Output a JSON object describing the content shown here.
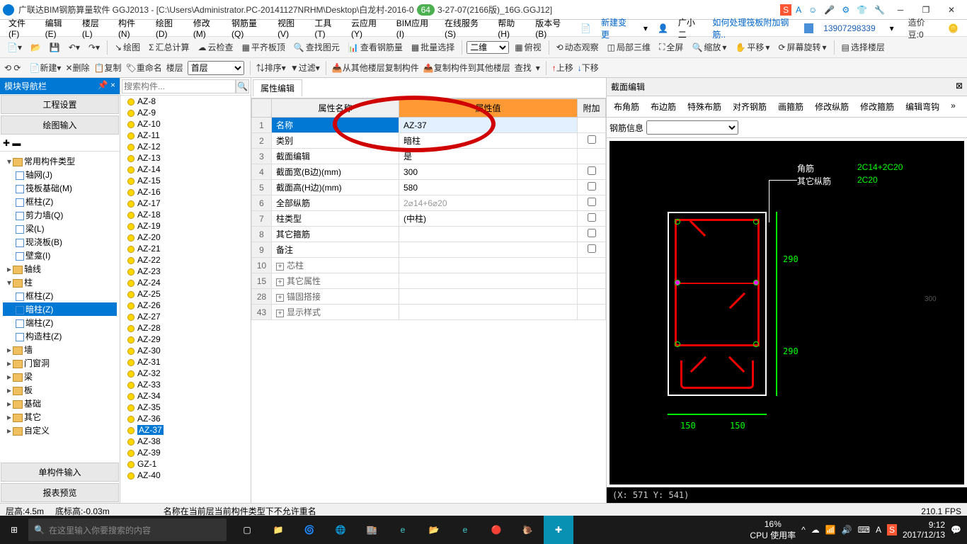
{
  "titlebar": {
    "title": "广联达BIM钢筋算量软件 GGJ2013 - [C:\\Users\\Administrator.PC-20141127NRHM\\Desktop\\白龙村-2016-0",
    "badge": "64",
    "title2": "3-27-07(2166版)_16G.GGJ12]"
  },
  "menu": [
    "文件(F)",
    "编辑(E)",
    "楼层(L)",
    "构件(N)",
    "绘图(D)",
    "修改(M)",
    "钢筋量(Q)",
    "视图(V)",
    "工具(T)",
    "云应用(Y)",
    "BIM应用(I)",
    "在线服务(S)",
    "帮助(H)",
    "版本号(B)"
  ],
  "menu_actions": {
    "newchange": "新建变更",
    "user": "广小二",
    "link": "如何处理筏板附加钢筋..",
    "userid": "13907298339",
    "credit": "造价豆:0"
  },
  "toolbar1": [
    "绘图",
    "汇总计算",
    "云检查",
    "平齐板顶",
    "查找图元",
    "查看钢筋量",
    "批量选择"
  ],
  "toolbar1b": [
    "二维",
    "俯视",
    "动态观察",
    "局部三维",
    "全屏",
    "缩放",
    "平移",
    "屏幕旋转",
    "选择楼层"
  ],
  "toolbar2": {
    "new": "新建",
    "del": "删除",
    "copy": "复制",
    "rename": "重命名",
    "floor": "楼层",
    "first": "首层",
    "sort": "排序",
    "filter": "过滤",
    "copyfrom": "从其他楼层复制构件",
    "copyto": "复制构件到其他楼层",
    "search": "查找",
    "up": "上移",
    "down": "下移"
  },
  "nav": {
    "header": "模块导航栏",
    "engset": "工程设置",
    "drawin": "绘图输入",
    "single": "单构件输入",
    "report": "报表预览"
  },
  "tree": [
    {
      "l": 1,
      "t": "常用构件类型",
      "exp": true,
      "f": true
    },
    {
      "l": 2,
      "t": "轴网(J)",
      "i": true
    },
    {
      "l": 2,
      "t": "筏板基础(M)",
      "i": true
    },
    {
      "l": 2,
      "t": "框柱(Z)",
      "i": true
    },
    {
      "l": 2,
      "t": "剪力墙(Q)",
      "i": true
    },
    {
      "l": 2,
      "t": "梁(L)",
      "i": true
    },
    {
      "l": 2,
      "t": "现浇板(B)",
      "i": true
    },
    {
      "l": 2,
      "t": "壁龛(I)",
      "i": true
    },
    {
      "l": 1,
      "t": "轴线",
      "f": true
    },
    {
      "l": 1,
      "t": "柱",
      "exp": true,
      "f": true
    },
    {
      "l": 2,
      "t": "框柱(Z)",
      "i": true
    },
    {
      "l": 2,
      "t": "暗柱(Z)",
      "i": true,
      "sel": true
    },
    {
      "l": 2,
      "t": "端柱(Z)",
      "i": true
    },
    {
      "l": 2,
      "t": "构造柱(Z)",
      "i": true
    },
    {
      "l": 1,
      "t": "墙",
      "f": true
    },
    {
      "l": 1,
      "t": "门窗洞",
      "f": true
    },
    {
      "l": 1,
      "t": "梁",
      "f": true
    },
    {
      "l": 1,
      "t": "板",
      "f": true
    },
    {
      "l": 1,
      "t": "基础",
      "f": true
    },
    {
      "l": 1,
      "t": "其它",
      "f": true
    },
    {
      "l": 1,
      "t": "自定义",
      "f": true
    }
  ],
  "search_placeholder": "搜索构件...",
  "components": [
    "AZ-8",
    "AZ-9",
    "AZ-10",
    "AZ-11",
    "AZ-12",
    "AZ-13",
    "AZ-14",
    "AZ-15",
    "AZ-16",
    "AZ-17",
    "AZ-18",
    "AZ-19",
    "AZ-20",
    "AZ-21",
    "AZ-22",
    "AZ-23",
    "AZ-24",
    "AZ-25",
    "AZ-26",
    "AZ-27",
    "AZ-28",
    "AZ-29",
    "AZ-30",
    "AZ-31",
    "AZ-32",
    "AZ-33",
    "AZ-34",
    "AZ-35",
    "AZ-36",
    "AZ-37",
    "AZ-38",
    "AZ-39",
    "GZ-1",
    "AZ-40"
  ],
  "components_sel": 29,
  "proptab": "属性编辑",
  "prophdr": {
    "name": "属性名称",
    "val": "属性值",
    "add": "附加"
  },
  "proprows": [
    {
      "n": "1",
      "l": "名称",
      "v": "AZ-37",
      "sel": true
    },
    {
      "n": "2",
      "l": "类别",
      "v": "暗柱",
      "cb": true
    },
    {
      "n": "3",
      "l": "截面编辑",
      "v": "是"
    },
    {
      "n": "4",
      "l": "截面宽(B边)(mm)",
      "v": "300",
      "cb": true
    },
    {
      "n": "5",
      "l": "截面高(H边)(mm)",
      "v": "580",
      "cb": true
    },
    {
      "n": "6",
      "l": "全部纵筋",
      "v": "2⌀14+6⌀20",
      "cb": true,
      "gray": true
    },
    {
      "n": "7",
      "l": "柱类型",
      "v": "(中柱)",
      "cb": true
    },
    {
      "n": "8",
      "l": "其它箍筋",
      "v": "",
      "cb": true
    },
    {
      "n": "9",
      "l": "备注",
      "v": "",
      "cb": true
    },
    {
      "n": "10",
      "l": "芯柱",
      "v": "",
      "exp": true
    },
    {
      "n": "15",
      "l": "其它属性",
      "v": "",
      "exp": true
    },
    {
      "n": "28",
      "l": "锚固搭接",
      "v": "",
      "exp": true
    },
    {
      "n": "43",
      "l": "显示样式",
      "v": "",
      "exp": true
    }
  ],
  "section": {
    "title": "截面编辑",
    "tabs": [
      "布角筋",
      "布边筋",
      "特殊布筋",
      "对齐钢筋",
      "画箍筋",
      "修改纵筋",
      "修改箍筋",
      "编辑弯钩"
    ],
    "rebar_label": "钢筋信息",
    "labels": {
      "corner": "角筋",
      "other": "其它纵筋",
      "c1": "2C14+2C20",
      "c2": "2C20"
    },
    "dims": {
      "v1": "290",
      "v2": "290",
      "h1": "150",
      "h2": "150",
      "h300": "300"
    },
    "coord": "(X: 571 Y: 541)"
  },
  "status": {
    "floor": "层高:4.5m",
    "bottom": "底标高:-0.03m",
    "msg": "名称在当前层当前构件类型下不允许重名",
    "fps": "210.1 FPS"
  },
  "taskbar": {
    "search": "在这里输入你要搜索的内容",
    "cpu": "16%",
    "cpulbl": "CPU 使用率",
    "time": "9:12",
    "date": "2017/12/13"
  }
}
